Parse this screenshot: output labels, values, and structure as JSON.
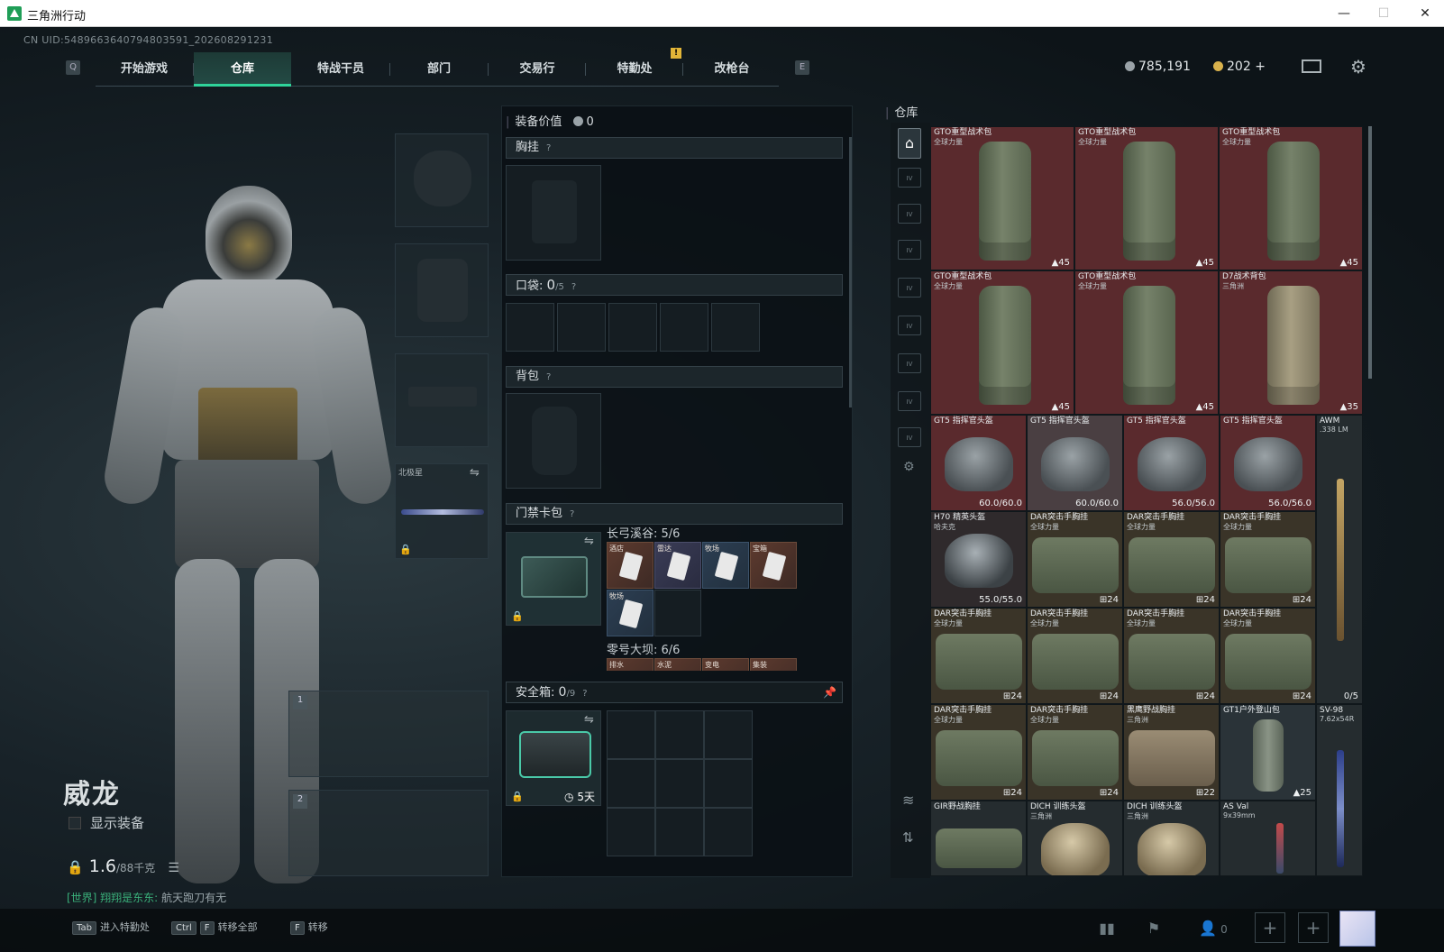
{
  "window": {
    "title": "三角洲行动"
  },
  "uid": "CN UID:5489663640794803591_202608291231",
  "nav": {
    "left_key": "Q",
    "right_key": "E",
    "alert": "!",
    "tabs": [
      "开始游戏",
      "仓库",
      "特战干员",
      "部门",
      "交易行",
      "特勤处",
      "改枪台"
    ],
    "active": "仓库"
  },
  "currency": {
    "silver": "785,191",
    "gold": "202",
    "gold_plus": "+"
  },
  "character": {
    "name": "威龙",
    "show_equipment": "显示装备",
    "weight": "1.6",
    "weight_unit": "/88千克",
    "chat_channel": "[世界] 翔翔是东东:",
    "chat_text": "航天跑刀有无",
    "weapon_slot_label": "北极星",
    "slot1": "1",
    "slot2": "2"
  },
  "equipment": {
    "value_label": "装备价值",
    "value": "0",
    "chest_label": "胸挂",
    "pocket_label": "口袋:",
    "pocket_count": "0",
    "pocket_max": "/5",
    "backpack_label": "背包",
    "keycard_label": "门禁卡包",
    "keycard_group1": "长弓溪谷: 5/6",
    "keycard_group2": "零号大坝: 6/6",
    "keycards1": [
      "酒店",
      "雷达",
      "牧场",
      "宝箱",
      "牧场"
    ],
    "keycards2": [
      "排水",
      "水泥",
      "变电",
      "集装"
    ],
    "safebox_label": "安全箱:",
    "safebox_count": "0",
    "safebox_max": "/9",
    "safebox_time": "5天",
    "help": "?"
  },
  "warehouse": {
    "title": "仓库",
    "items": [
      {
        "name": "GTO重型战术包",
        "sub": "全球力量",
        "badge": "45"
      },
      {
        "name": "GTO重型战术包",
        "sub": "全球力量",
        "badge": "45"
      },
      {
        "name": "GTO重型战术包",
        "sub": "全球力量",
        "badge": "45"
      },
      {
        "name": "GTO重型战术包",
        "sub": "全球力量",
        "badge": "45"
      },
      {
        "name": "GTO重型战术包",
        "sub": "全球力量",
        "badge": "45"
      },
      {
        "name": "D7战术背包",
        "sub": "三角洲",
        "badge": "35"
      },
      {
        "name": "GT5 指挥官头盔",
        "sub": "",
        "badge": "60.0/60.0"
      },
      {
        "name": "GT5 指挥官头盔",
        "sub": "",
        "badge": "60.0/60.0"
      },
      {
        "name": "GT5 指挥官头盔",
        "sub": "",
        "badge": "56.0/56.0"
      },
      {
        "name": "GT5 指挥官头盔",
        "sub": "",
        "badge": "56.0/56.0"
      },
      {
        "name": "AWM",
        ".sub": "",
        "sub": ".338 LM",
        "badge": "0/5"
      },
      {
        "name": "H70 精英头盔",
        "sub": "哈夫克",
        "badge": "55.0/55.0"
      },
      {
        "name": "DAR突击手胸挂",
        "sub": "全球力量",
        "badge": "24"
      },
      {
        "name": "DAR突击手胸挂",
        "sub": "全球力量",
        "badge": "24"
      },
      {
        "name": "DAR突击手胸挂",
        "sub": "全球力量",
        "badge": "24"
      },
      {
        "name": "DAR突击手胸挂",
        "sub": "全球力量",
        "badge": "24"
      },
      {
        "name": "DAR突击手胸挂",
        "sub": "全球力量",
        "badge": "24"
      },
      {
        "name": "DAR突击手胸挂",
        "sub": "全球力量",
        "badge": "24"
      },
      {
        "name": "DAR突击手胸挂",
        "sub": "全球力量",
        "badge": "24"
      },
      {
        "name": "DAR突击手胸挂",
        "sub": "全球力量",
        "badge": "24"
      },
      {
        "name": "DAR突击手胸挂",
        "sub": "全球力量",
        "badge": "24"
      },
      {
        "name": "黑鹰野战胸挂",
        "sub": "三角洲",
        "badge": "22"
      },
      {
        "name": "GT1户外登山包",
        "sub": "",
        "badge": "25"
      },
      {
        "name": "SV-98",
        "sub": "7.62x54R",
        "badge": ""
      },
      {
        "name": "GIR野战胸挂",
        "sub": "",
        "badge": ""
      },
      {
        "name": "DICH 训练头盔",
        "sub": "三角洲",
        "badge": ""
      },
      {
        "name": "DICH 训练头盔",
        "sub": "三角洲",
        "badge": ""
      },
      {
        "name": "AS Val",
        "sub": "9x39mm",
        "badge": ""
      }
    ]
  },
  "bottom": {
    "tab_key": "Tab",
    "tab_label": "进入特勤处",
    "ctrl_key": "Ctrl",
    "f_key": "F",
    "transfer_all": "转移全部",
    "f2_key": "F",
    "transfer": "转移",
    "team_count": "0"
  },
  "colors": {
    "accent": "#2fd39a",
    "item_red": "#5a2a2d",
    "chat_green": "#3ab07a"
  }
}
